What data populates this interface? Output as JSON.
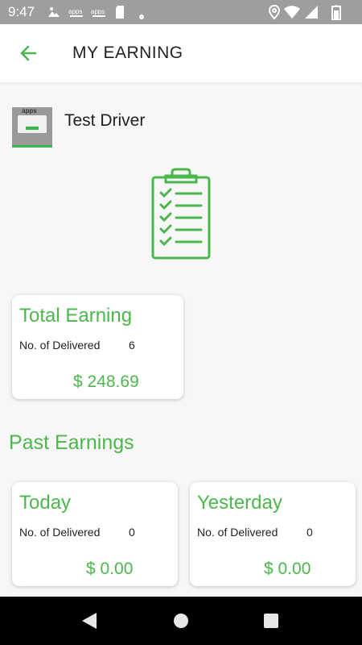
{
  "status_bar": {
    "time": "9:47",
    "notif_icons": [
      "photo-icon",
      "apps-icon",
      "apps-icon",
      "sd-card-icon",
      "dot-icon"
    ],
    "notif_labels": [
      "apps",
      "apps"
    ],
    "right_icons": [
      "location-icon",
      "wifi-icon",
      "signal-icon",
      "battery-icon"
    ]
  },
  "header": {
    "title": "MY EARNING",
    "back_icon": "arrow-left-icon"
  },
  "profile": {
    "name": "Test Driver",
    "avatar_text": "apps"
  },
  "colors": {
    "accent": "#4cb74c",
    "status_bar": "#9e9e9e",
    "nav_bar": "#000000"
  },
  "total": {
    "title": "Total Earning",
    "delivered_label": "No. of Delivered",
    "delivered_count": "6",
    "amount": "$ 248.69"
  },
  "past": {
    "title": "Past Earnings",
    "cards": [
      {
        "title": "Today",
        "delivered_label": "No. of Delivered",
        "delivered_count": "0",
        "amount": "$ 0.00"
      },
      {
        "title": "Yesterday",
        "delivered_label": "No. of Delivered",
        "delivered_count": "0",
        "amount": "$ 0.00"
      }
    ]
  },
  "nav": {
    "icons": [
      "back-triangle-icon",
      "home-circle-icon",
      "recents-square-icon"
    ]
  }
}
